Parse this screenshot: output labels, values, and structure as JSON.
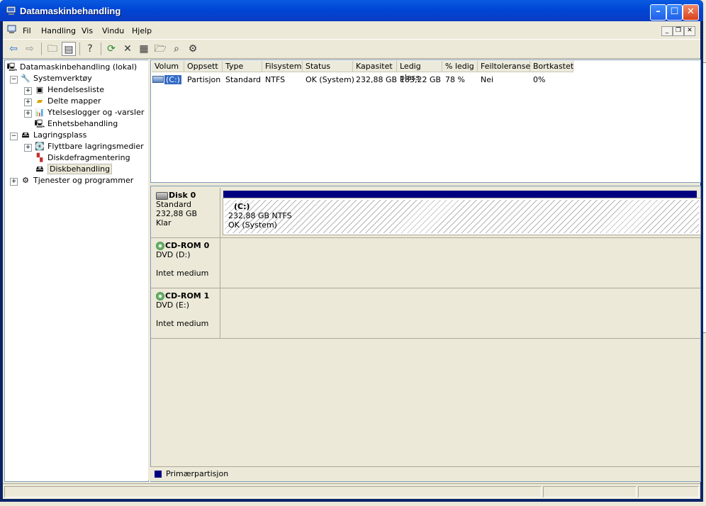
{
  "window": {
    "title": "Datamaskinbehandling",
    "min_label": "–",
    "max_label": "☐",
    "close_label": "✕"
  },
  "menu": {
    "items": [
      "Fil",
      "Handling",
      "Vis",
      "Vindu",
      "Hjelp"
    ]
  },
  "tree": {
    "root": "Datamaskinbehandling (lokal)",
    "systemverktoy": "Systemverktøy",
    "hendelsesliste": "Hendelsesliste",
    "delte_mapper": "Delte mapper",
    "ytelseslogger": "Ytelseslogger og -varsler",
    "enhetsbehandling": "Enhetsbehandling",
    "lagringsplass": "Lagringsplass",
    "flyttbare": "Flyttbare lagringsmedier",
    "diskdefrag": "Diskdefragmentering",
    "diskbehandling": "Diskbehandling",
    "tjenester": "Tjenester og programmer"
  },
  "volume_list": {
    "columns": [
      "Volum",
      "Oppsett",
      "Type",
      "Filsystem",
      "Status",
      "Kapasitet",
      "Ledig plass",
      "% ledig",
      "Feiltoleranse",
      "Bortkastet"
    ],
    "rows": [
      [
        "(C:)",
        "Partisjon",
        "Standard",
        "NTFS",
        "OK (System)",
        "232,88 GB",
        "183,22 GB",
        "78 %",
        "Nei",
        "0%"
      ]
    ]
  },
  "disks": [
    {
      "name": "Disk 0",
      "line1": "Standard",
      "line2": "232,88 GB",
      "line3": "Klar",
      "partition": {
        "label": "(C:)",
        "size": "232,88 GB NTFS",
        "status": "OK (System)"
      }
    },
    {
      "name": "CD-ROM 0",
      "line1": "DVD (D:)",
      "line2": "",
      "line3": "Intet medium"
    },
    {
      "name": "CD-ROM 1",
      "line1": "DVD (E:)",
      "line2": "",
      "line3": "Intet medium"
    }
  ],
  "legend": {
    "primary": "Primærpartisjon"
  },
  "colors": {
    "primary_partition": "#000080",
    "titlebar": "#0046d5",
    "selection": "#316ac5"
  }
}
